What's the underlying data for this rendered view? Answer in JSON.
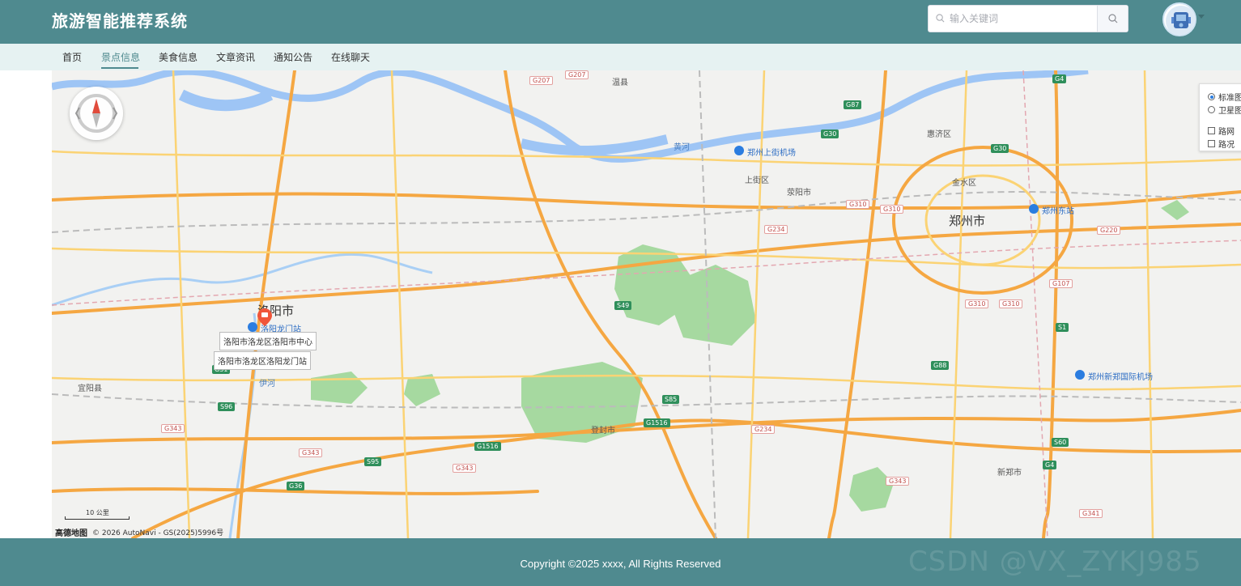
{
  "header": {
    "title": "旅游智能推荐系统",
    "search_placeholder": "输入关键词",
    "brand_color": "#4f8a8f"
  },
  "nav": {
    "items": [
      {
        "label": "首页"
      },
      {
        "label": "景点信息"
      },
      {
        "label": "美食信息"
      },
      {
        "label": "文章资讯"
      },
      {
        "label": "通知公告"
      },
      {
        "label": "在线聊天"
      }
    ],
    "active": "景点信息"
  },
  "map": {
    "layers": {
      "standard": "标准图",
      "satellite": "卫星图",
      "roadnet": "路网",
      "traffic": "路况"
    },
    "cities": [
      "洛阳市",
      "郑州市"
    ],
    "districts": [
      "温县",
      "惠济区",
      "金水区",
      "上街区",
      "荥阳市",
      "宜阳县",
      "登封市",
      "新郑市"
    ],
    "pois": [
      "郑州上街机场",
      "郑州东站",
      "郑州新郑国际机场",
      "洛阳龙门站"
    ],
    "rivers": [
      "黄河",
      "伊河"
    ],
    "road_shields": [
      "G207",
      "G207",
      "G87",
      "G30",
      "G30",
      "G4",
      "G310",
      "G310",
      "G234",
      "G220",
      "G107",
      "G310",
      "G310",
      "S1",
      "S49",
      "G88",
      "S85",
      "G1516",
      "G1516",
      "S95",
      "G343",
      "G343",
      "G343",
      "G36",
      "G234",
      "S60",
      "G4",
      "G343",
      "G341",
      "G31",
      "S96"
    ],
    "marker_tooltips": [
      "洛阳市洛龙区洛阳市中心",
      "洛阳市洛龙区洛阳龙门站"
    ],
    "scale": "10 公里",
    "logo": "高德地图",
    "attribution": "© 2026 AutoNavi - GS(2025)5996号"
  },
  "footer": {
    "copyright": "Copyright ©2025 xxxx, All Rights Reserved",
    "watermark": "CSDN @VX_ZYKJ985"
  }
}
